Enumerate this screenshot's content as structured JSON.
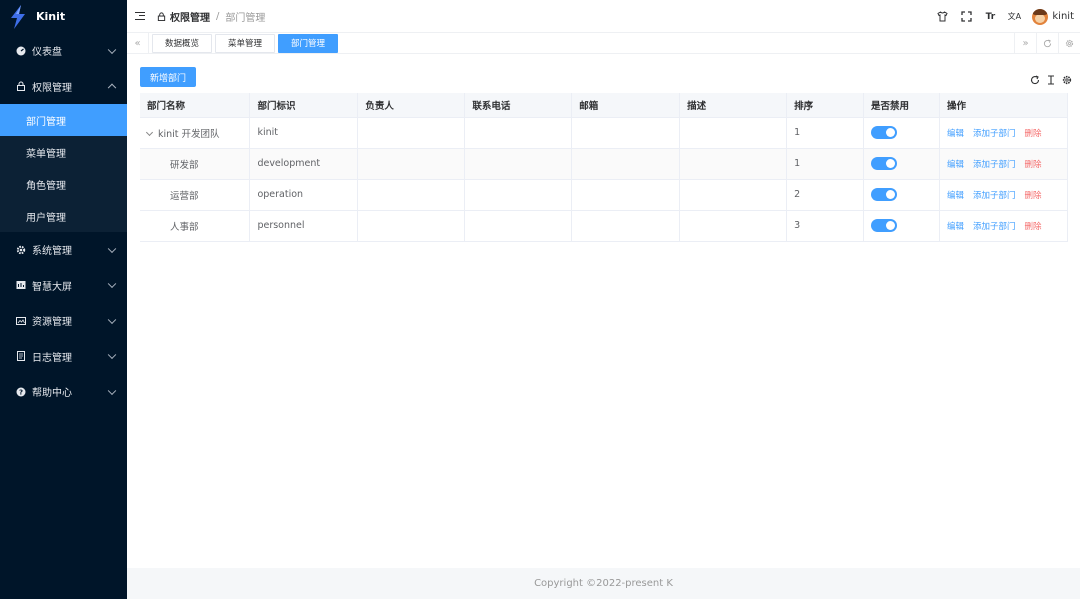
{
  "app": {
    "name": "Kinit"
  },
  "sidebar": {
    "items": [
      {
        "label": "仪表盘",
        "icon": "dashboard-icon"
      },
      {
        "label": "权限管理",
        "icon": "lock-icon",
        "children": [
          {
            "label": "部门管理",
            "active": true
          },
          {
            "label": "菜单管理"
          },
          {
            "label": "角色管理"
          },
          {
            "label": "用户管理"
          }
        ]
      },
      {
        "label": "系统管理",
        "icon": "gear-icon"
      },
      {
        "label": "智慧大屏",
        "icon": "chart-icon"
      },
      {
        "label": "资源管理",
        "icon": "image-icon"
      },
      {
        "label": "日志管理",
        "icon": "document-icon"
      },
      {
        "label": "帮助中心",
        "icon": "help-icon"
      }
    ]
  },
  "header": {
    "breadcrumb": [
      "权限管理",
      "部门管理"
    ],
    "user": "kinit",
    "icons": [
      "shirt-icon",
      "fullscreen-icon",
      "font-size-icon",
      "translate-icon"
    ],
    "font_size_label": "Tr",
    "translate_label": "文A"
  },
  "tags": [
    {
      "label": "数据概览"
    },
    {
      "label": "菜单管理"
    },
    {
      "label": "部门管理",
      "active": true
    }
  ],
  "toolbar": {
    "add_label": "新增部门"
  },
  "table": {
    "columns": [
      "部门名称",
      "部门标识",
      "负责人",
      "联系电话",
      "邮箱",
      "描述",
      "排序",
      "是否禁用",
      "操作"
    ],
    "rows": [
      {
        "name": "kinit 开发团队",
        "key": "kinit",
        "leader": "",
        "phone": "",
        "email": "",
        "desc": "",
        "order": "1",
        "disabled": true
      },
      {
        "name": "研发部",
        "key": "development",
        "leader": "",
        "phone": "",
        "email": "",
        "desc": "",
        "order": "1",
        "disabled": true
      },
      {
        "name": "运营部",
        "key": "operation",
        "leader": "",
        "phone": "",
        "email": "",
        "desc": "",
        "order": "2",
        "disabled": true
      },
      {
        "name": "人事部",
        "key": "personnel",
        "leader": "",
        "phone": "",
        "email": "",
        "desc": "",
        "order": "3",
        "disabled": true
      }
    ],
    "actions": {
      "edit": "编辑",
      "add_child": "添加子部门",
      "delete": "删除"
    }
  },
  "footer": {
    "copyright": "Copyright ©2022-present K"
  },
  "colors": {
    "primary": "#409eff",
    "sidebar_bg": "#001529",
    "danger": "#f56c6c"
  }
}
